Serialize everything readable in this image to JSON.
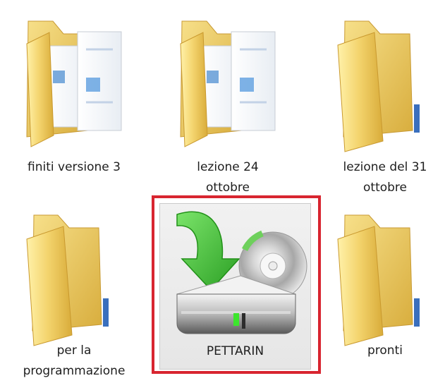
{
  "folder_items": [
    {
      "name": "finiti versione 3",
      "label_lines": [
        "finiti versione 3"
      ],
      "icon": "folder-with-documents-icon"
    },
    {
      "name": "lezione 24 ottobre",
      "label_lines": [
        "lezione 24",
        "ottobre"
      ],
      "icon": "folder-with-documents-icon"
    },
    {
      "name": "lezione del 31 ottobre",
      "label_lines": [
        "lezione del 31",
        "ottobre"
      ],
      "icon": "folder-icon"
    },
    {
      "name": "per la programmazione",
      "label_lines": [
        "per la",
        "programmazione"
      ],
      "icon": "folder-icon"
    },
    {
      "name": "pronti",
      "label_lines": [
        "pronti"
      ],
      "icon": "folder-icon"
    }
  ],
  "drive": {
    "label": "PETTARIN",
    "icon": "optical-drive-install-icon",
    "selected": true,
    "highlight_color": "#d82530"
  },
  "colors": {
    "folder": "#f3d46f",
    "folder_dark": "#d9ad3c",
    "arrow": "#46b82e",
    "drive_selection_bg": "#ececec"
  }
}
